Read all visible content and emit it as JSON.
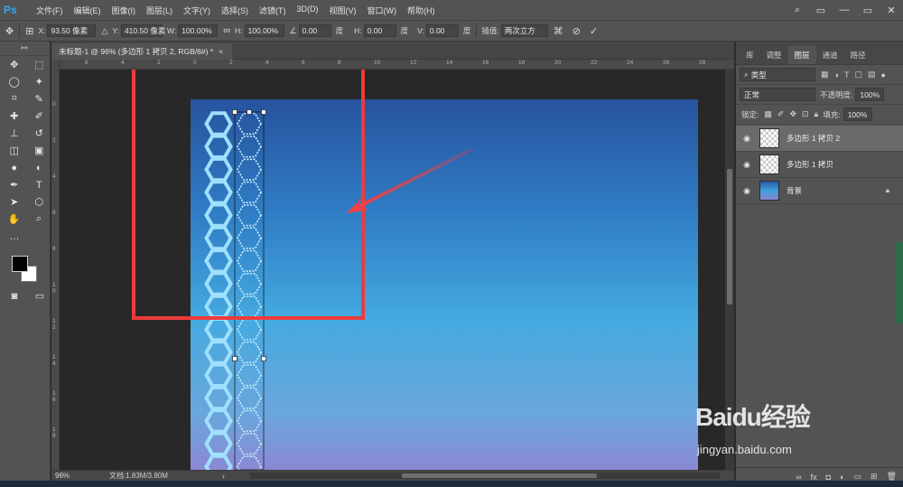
{
  "app": {
    "logo": "Ps",
    "menus": [
      "文件(F)",
      "编辑(E)",
      "图像(I)",
      "图层(L)",
      "文字(Y)",
      "选择(S)",
      "滤镜(T)",
      "3D(D)",
      "视图(V)",
      "窗口(W)",
      "帮助(H)"
    ],
    "window_controls": [
      "—",
      "▭",
      "✕"
    ]
  },
  "options": {
    "x_label": "X:",
    "x_value": "93.50 像素",
    "y_label": "Y:",
    "y_value": "410.50 像素",
    "w_label": "W:",
    "w_value": "100.00%",
    "h_label": "H:",
    "h_value": "100.00%",
    "rot_value": "0.00",
    "rot_unit": "度",
    "hskew_label": "H:",
    "hskew_value": "0.00",
    "hskew_unit": "度",
    "vskew_label": "V:",
    "vskew_value": "0.00",
    "vskew_unit": "度",
    "interp_label": "插值:",
    "interp_value": "两次立方"
  },
  "document": {
    "tab_title": "未标题-1 @ 96% (多边形 1 拷贝 2, RGB/8#) *",
    "zoom": "96%",
    "doc_size": "文档:1.83M/3.80M",
    "ruler_h_ticks": [
      "6",
      "4",
      "2",
      "0",
      "2",
      "4",
      "6",
      "8",
      "10",
      "12",
      "14",
      "16",
      "18",
      "20",
      "22",
      "24",
      "26",
      "28"
    ],
    "ruler_v_ticks": [
      "0",
      "2",
      "4",
      "6",
      "8",
      "1 0",
      "1 2",
      "1 4",
      "1 6",
      "1 8"
    ]
  },
  "panels": {
    "tabs": [
      "库",
      "调整",
      "图层",
      "通道",
      "路径"
    ],
    "active_tab": "图层",
    "filter_kind": "类型",
    "blend_mode": "正常",
    "opacity_label": "不透明度:",
    "opacity_value": "100%",
    "lock_label": "锁定:",
    "fill_label": "填充:",
    "fill_value": "100%",
    "layers": [
      {
        "name": "多边形 1 拷贝 2",
        "selected": true
      },
      {
        "name": "多边形 1 拷贝",
        "selected": false
      },
      {
        "name": "背景",
        "selected": false,
        "locked": true
      }
    ]
  },
  "watermark": {
    "logo": "Baidu经验",
    "url": "jingyan.baidu.com"
  }
}
